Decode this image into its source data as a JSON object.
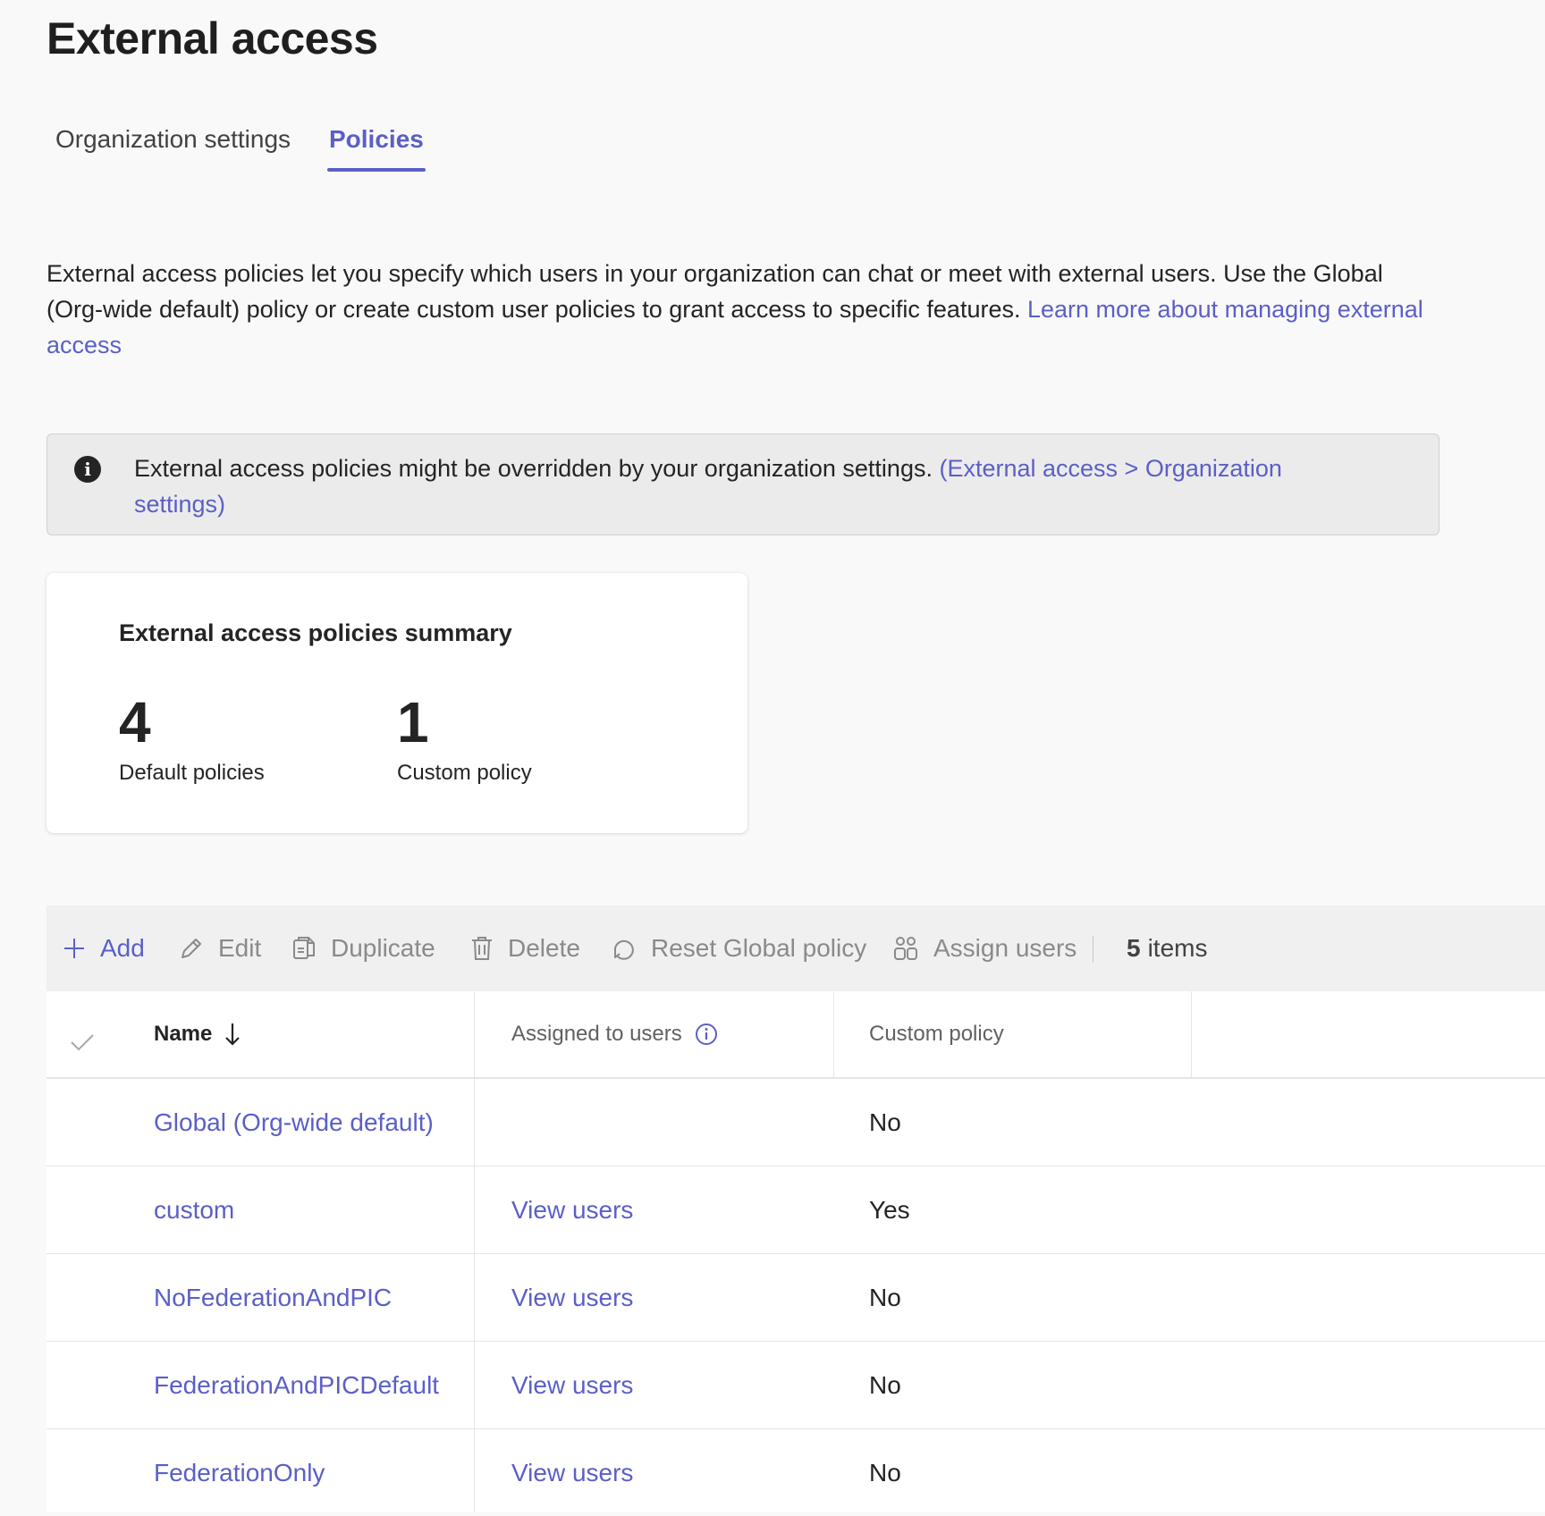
{
  "page": {
    "title": "External access"
  },
  "tabs": [
    {
      "label": "Organization settings",
      "selected": false
    },
    {
      "label": "Policies",
      "selected": true
    }
  ],
  "intro": {
    "text": "External access policies let you specify which users in your organization can chat or meet with external users. Use the Global (Org-wide default) policy or create custom user policies to grant access to specific features.",
    "link": "Learn more about managing external access"
  },
  "banner": {
    "text": "External access policies might be overridden by your organization settings.",
    "link": "(External access > Organization settings)"
  },
  "summary": {
    "title": "External access policies summary",
    "default_count": "4",
    "default_label": "Default policies",
    "custom_count": "1",
    "custom_label": "Custom policy"
  },
  "toolbar": {
    "add": "Add",
    "edit": "Edit",
    "duplicate": "Duplicate",
    "delete": "Delete",
    "reset": "Reset Global policy",
    "assign": "Assign users",
    "count": "5",
    "count_suffix": "items"
  },
  "table": {
    "columns": {
      "name": "Name",
      "assigned": "Assigned to users",
      "custom": "Custom policy"
    },
    "rows": [
      {
        "name": "Global (Org-wide default)",
        "assigned": "",
        "custom": "No"
      },
      {
        "name": "custom",
        "assigned": "View users",
        "custom": "Yes"
      },
      {
        "name": "NoFederationAndPIC",
        "assigned": "View users",
        "custom": "No"
      },
      {
        "name": "FederationAndPICDefault",
        "assigned": "View users",
        "custom": "No"
      },
      {
        "name": "FederationOnly",
        "assigned": "View users",
        "custom": "No"
      }
    ]
  },
  "colors": {
    "accent": "#5b5fc7",
    "disabled": "#8a8a8a",
    "banner_bg": "#ebebeb"
  }
}
